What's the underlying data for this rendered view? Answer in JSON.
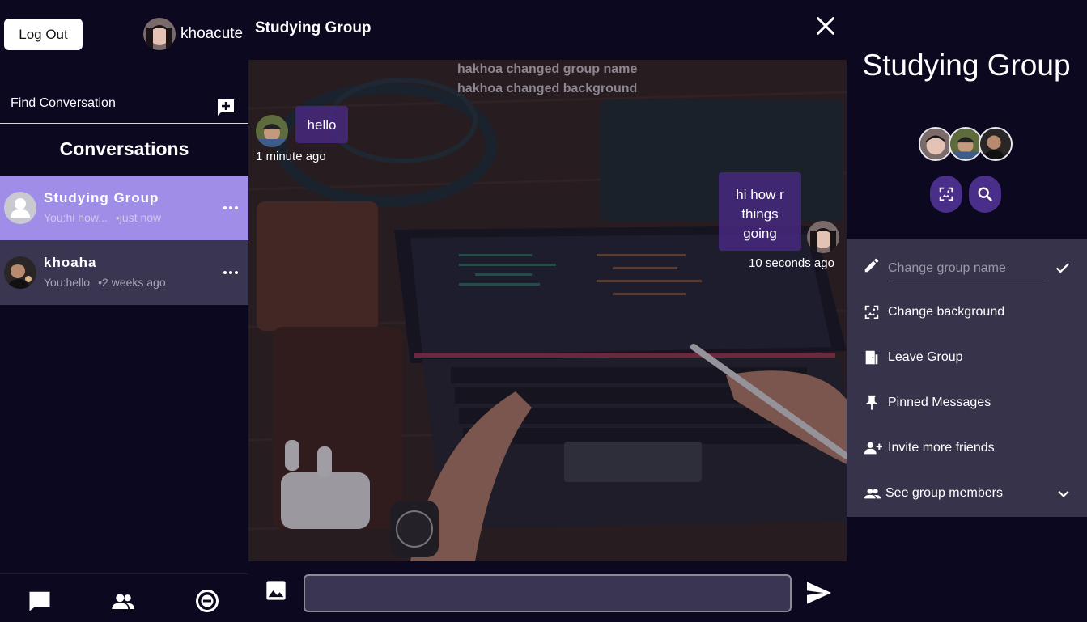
{
  "user": {
    "name": "khoacute",
    "logout_label": "Log Out"
  },
  "sidebar": {
    "find_label": "Find Conversation",
    "heading": "Conversations",
    "conversations": [
      {
        "name": "Studying Group",
        "preview": "You:hi how...",
        "time": "•just now"
      },
      {
        "name": "khoaha",
        "preview": "You:hello",
        "time": "•2 weeks ago"
      }
    ],
    "nav_icons": [
      "chat-icon",
      "friends-icon",
      "blocked-icon"
    ]
  },
  "chat": {
    "title": "Studying Group",
    "system_messages": [
      "hakhoa changed group name",
      "hakhoa changed background"
    ],
    "messages": [
      {
        "text": "hello",
        "time": "1 minute ago",
        "side": "left"
      },
      {
        "text": "hi how r things going",
        "time": "10 seconds ago",
        "side": "right"
      }
    ],
    "composer_placeholder": ""
  },
  "panel": {
    "group_name": "Studying Group",
    "menu": {
      "rename_placeholder": "Change group name",
      "change_background": "Change background",
      "leave_group": "Leave Group",
      "pinned_messages": "Pinned Messages",
      "invite_friends": "Invite more friends",
      "see_members": "See group members"
    }
  },
  "colors": {
    "background": "#0c0820",
    "active_conversation": "#9f8de8",
    "bubble": "#482882",
    "panel_menu": "#37334b",
    "action_button": "#4a2f8a"
  }
}
